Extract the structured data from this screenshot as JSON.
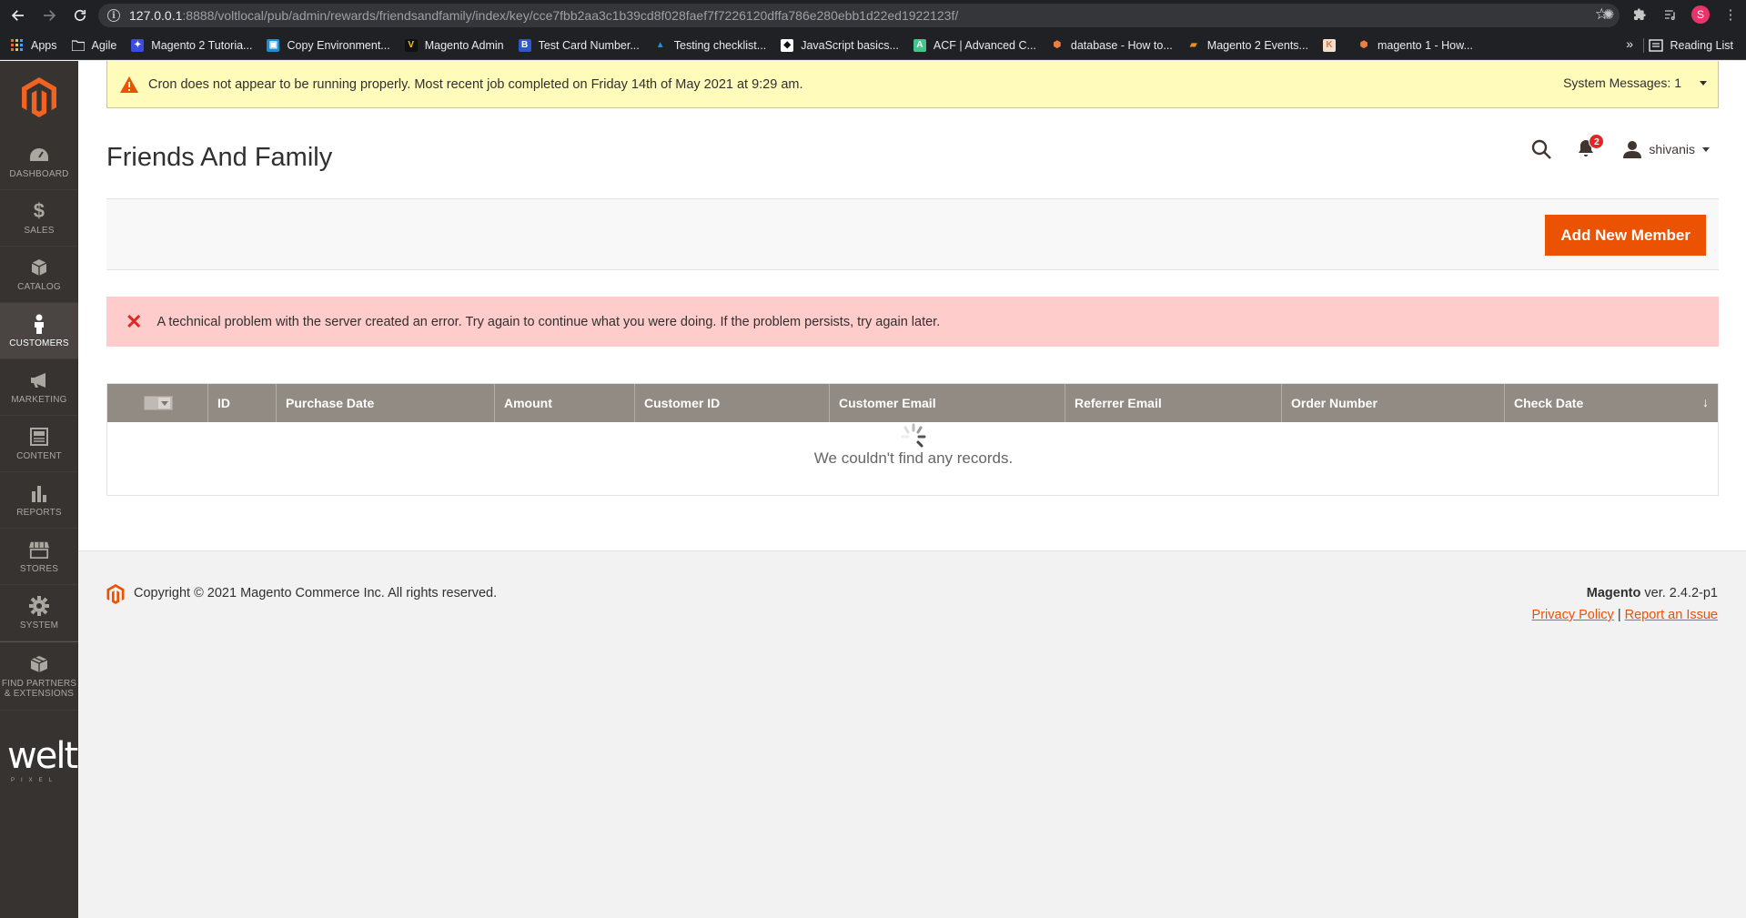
{
  "browser": {
    "url_host": "127.0.0.1",
    "url_rest": ":8888/voltlocal/pub/admin/rewards/friendsandfamily/index/key/cce7fbb2aa3c1b39cd8f028faef7f7226120dffa786e280ebb1d22ed1922123f/",
    "profile_initial": "S",
    "bookmarks": [
      {
        "label": "Apps",
        "icon": "apps-grid-icon",
        "color": ""
      },
      {
        "label": "Agile",
        "icon": "folder-icon",
        "color": "#e8eaed"
      },
      {
        "label": "Magento 2 Tutoria...",
        "icon": "bookmark-icon",
        "color": "#3b4ce0"
      },
      {
        "label": "Copy Environment...",
        "icon": "bookmark-icon",
        "color": "#1a8fd1"
      },
      {
        "label": "Magento Admin",
        "icon": "bookmark-icon",
        "color": "#f2c230"
      },
      {
        "label": "Test Card Number...",
        "icon": "bookmark-icon",
        "color": "#2c58c9"
      },
      {
        "label": "Testing checklist...",
        "icon": "bookmark-icon",
        "color": "#1f8ded"
      },
      {
        "label": "JavaScript basics...",
        "icon": "bookmark-icon",
        "color": "#111111"
      },
      {
        "label": "ACF | Advanced C...",
        "icon": "bookmark-icon",
        "color": "#45c48b"
      },
      {
        "label": "database - How to...",
        "icon": "bookmark-icon",
        "color": "#ef7d3c"
      },
      {
        "label": "Magento 2 Events...",
        "icon": "bookmark-icon",
        "color": "#ef8f22"
      },
      {
        "label": "",
        "icon": "bookmark-icon",
        "color": "#d97a46"
      },
      {
        "label": "magento 1 - How...",
        "icon": "bookmark-icon",
        "color": "#ef7d3c"
      }
    ],
    "more_label": "»",
    "reading_list": "Reading List"
  },
  "sidebar": {
    "items": [
      {
        "label": "DASHBOARD",
        "icon": "dashboard-icon"
      },
      {
        "label": "SALES",
        "icon": "dollar-icon"
      },
      {
        "label": "CATALOG",
        "icon": "box-icon"
      },
      {
        "label": "CUSTOMERS",
        "icon": "person-icon"
      },
      {
        "label": "MARKETING",
        "icon": "megaphone-icon"
      },
      {
        "label": "CONTENT",
        "icon": "content-icon"
      },
      {
        "label": "REPORTS",
        "icon": "bar-chart-icon"
      },
      {
        "label": "STORES",
        "icon": "store-icon"
      },
      {
        "label": "SYSTEM",
        "icon": "gear-icon"
      }
    ],
    "partners_line1": "FIND PARTNERS",
    "partners_line2": "& EXTENSIONS",
    "brand": "welt",
    "brand_sub": "PIXEL"
  },
  "system_message": {
    "text": "Cron does not appear to be running properly. Most recent job completed on Friday 14th of May 2021 at 9:29 am.",
    "count_label": "System Messages: 1"
  },
  "header": {
    "title": "Friends And Family",
    "notification_count": "2",
    "username": "shivanis"
  },
  "actions": {
    "add_new": "Add New Member"
  },
  "error": {
    "text": "A technical problem with the server created an error. Try again to continue what you were doing. If the problem persists, try again later."
  },
  "grid": {
    "columns": [
      "ID",
      "Purchase Date",
      "Amount",
      "Customer ID",
      "Customer Email",
      "Referrer Email",
      "Order Number",
      "Check Date"
    ],
    "empty_text": "We couldn't find any records.",
    "sort_indicator": "↓"
  },
  "footer": {
    "copyright": "Copyright © 2021 Magento Commerce Inc. All rights reserved.",
    "brand": "Magento",
    "version": " ver. 2.4.2-p1",
    "privacy": "Privacy Policy",
    "separator": " | ",
    "report": "Report an Issue"
  },
  "colors": {
    "accent": "#eb5202",
    "sidebar_bg": "#373330",
    "warning_bg": "#fffbbb",
    "error_bg": "#ffcccc",
    "grid_header": "#918b84"
  }
}
